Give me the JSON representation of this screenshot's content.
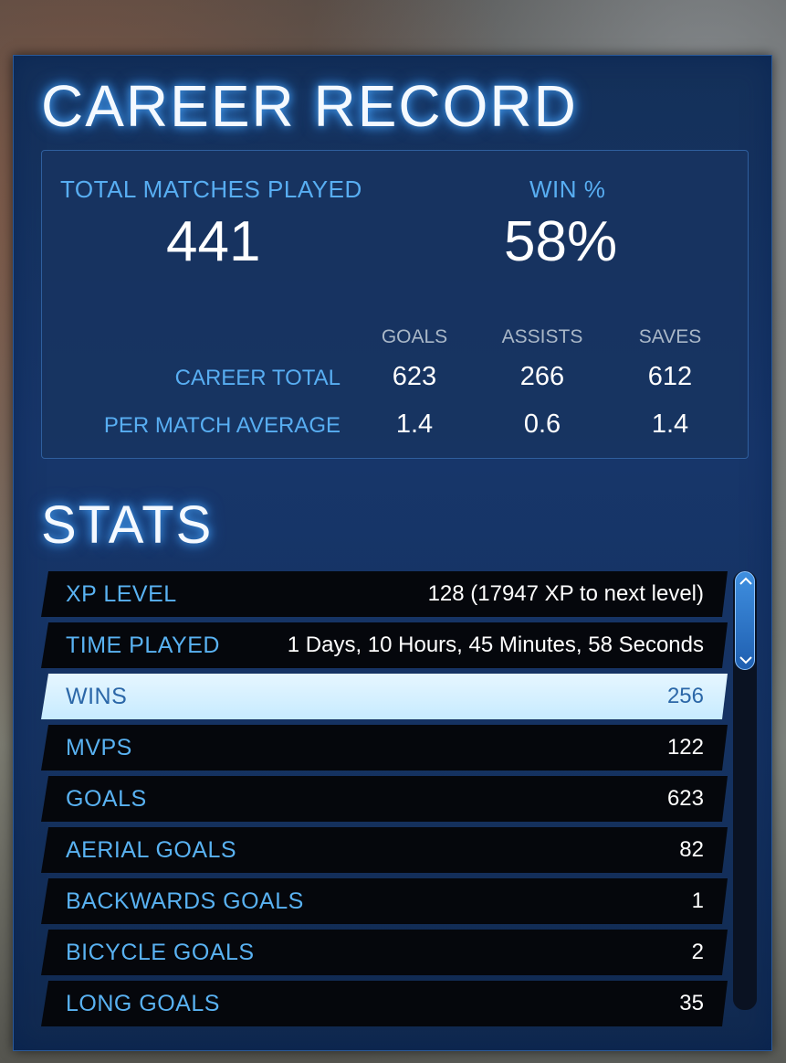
{
  "career": {
    "title": "CAREER RECORD",
    "total_matches_label": "TOTAL MATCHES PLAYED",
    "total_matches_value": "441",
    "win_pct_label": "WIN %",
    "win_pct_value": "58%",
    "columns": [
      "GOALS",
      "ASSISTS",
      "SAVES"
    ],
    "rows": [
      {
        "label": "CAREER TOTAL",
        "values": [
          "623",
          "266",
          "612"
        ]
      },
      {
        "label": "PER MATCH AVERAGE",
        "values": [
          "1.4",
          "0.6",
          "1.4"
        ]
      }
    ]
  },
  "stats": {
    "title": "STATS",
    "items": [
      {
        "name": "XP LEVEL",
        "value": "128 (17947 XP to next level)"
      },
      {
        "name": "TIME PLAYED",
        "value": "1 Days, 10 Hours, 45 Minutes, 58 Seconds"
      },
      {
        "name": "WINS",
        "value": "256"
      },
      {
        "name": "MVPS",
        "value": "122"
      },
      {
        "name": "GOALS",
        "value": "623"
      },
      {
        "name": "AERIAL GOALS",
        "value": "82"
      },
      {
        "name": "BACKWARDS GOALS",
        "value": "1"
      },
      {
        "name": "BICYCLE GOALS",
        "value": "2"
      },
      {
        "name": "LONG GOALS",
        "value": "35"
      }
    ],
    "selected_index": 2
  },
  "scrollbar": {
    "up_icon": "chevron-up-icon",
    "down_icon": "chevron-down-icon"
  }
}
